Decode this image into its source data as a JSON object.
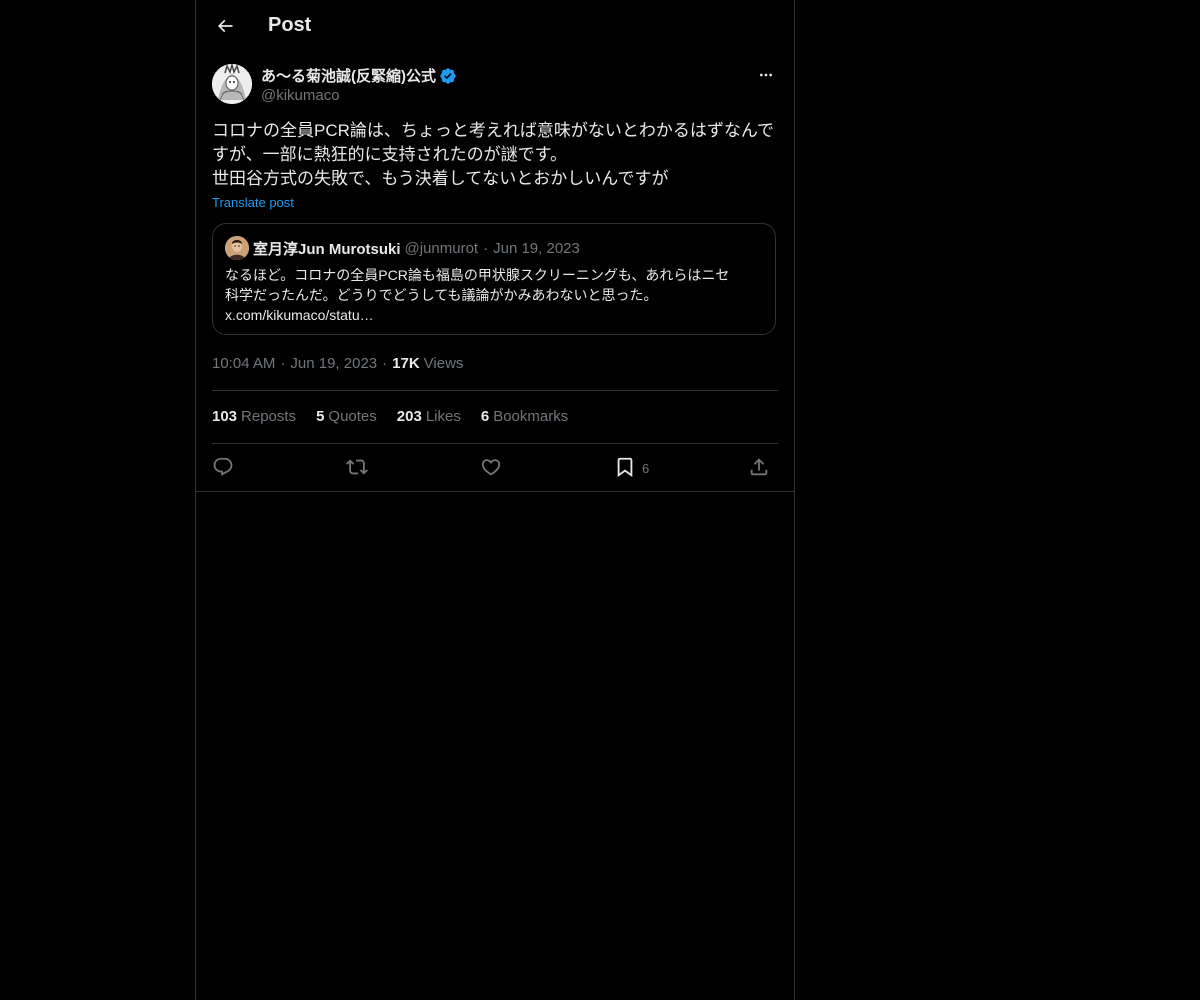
{
  "header": {
    "title": "Post",
    "back_icon": "arrow-left-icon"
  },
  "post": {
    "author": {
      "name": "あ〜る菊池誠(反緊縮)公式",
      "handle": "@kikumaco",
      "verified": true
    },
    "text_lines": [
      "コロナの全員PCR論は、ちょっと考えれば意味がないとわかるはずなんで",
      "すが、一部に熱狂的に支持されたのが謎です。",
      "世田谷方式の失敗で、もう決着してないとおかしいんですが"
    ],
    "translate_label": "Translate post",
    "time": "10:04 AM",
    "date": "Jun 19, 2023",
    "views_count": "17K",
    "views_label": "Views"
  },
  "quote": {
    "name": "室月淳Jun Murotsuki",
    "handle": "@junmurot",
    "date": "Jun 19, 2023",
    "text_lines": [
      "なるほど。コロナの全員PCR論も福島の甲状腺スクリーニングも、あれらはニセ",
      "科学だったんだ。どうりでどうしても議論がかみあわないと思った。",
      "x.com/kikumaco/statu…"
    ]
  },
  "stats": {
    "reposts": {
      "count": "103",
      "label": "Reposts"
    },
    "quotes": {
      "count": "5",
      "label": "Quotes"
    },
    "likes": {
      "count": "203",
      "label": "Likes"
    },
    "bookmarks": {
      "count": "6",
      "label": "Bookmarks"
    }
  },
  "actions": {
    "bookmark_count": "6",
    "icons": [
      "reply-icon",
      "repost-icon",
      "like-icon",
      "bookmark-icon",
      "share-icon"
    ]
  },
  "colors": {
    "background": "#000000",
    "text": "#e7e9ea",
    "muted": "#71767b",
    "border": "#2f3336",
    "accent": "#1d9bf0"
  },
  "separator": "·"
}
